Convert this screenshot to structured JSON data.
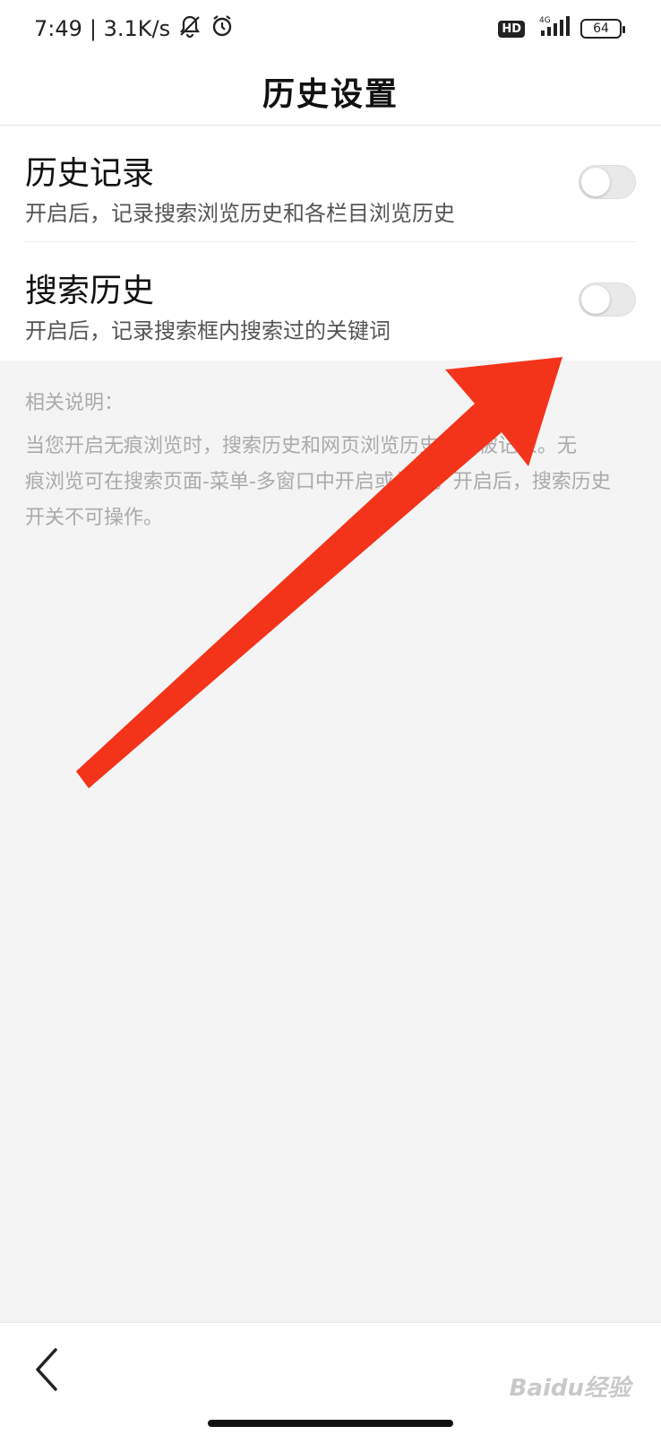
{
  "status_bar": {
    "time": "7:49",
    "network_speed": "| 3.1K/s",
    "mute_icon": "bell-off-icon",
    "alarm_icon": "alarm-clock-icon",
    "hd_label": "HD",
    "network_type": "4G",
    "battery": "64"
  },
  "header": {
    "title": "历史设置"
  },
  "settings": [
    {
      "title": "历史记录",
      "description": "开启后，记录搜索浏览历史和各栏目浏览历史",
      "enabled": false
    },
    {
      "title": "搜索历史",
      "description": "开启后，记录搜索框内搜索过的关键词",
      "enabled": false
    }
  ],
  "notes": {
    "heading": "相关说明：",
    "lines": [
      "当您开启无痕浏览时，搜索历史和网页浏览历史不会被记录。无",
      "痕浏览可在搜索页面-菜单-多窗口中开启或关闭。开启后，搜索历史",
      "开关不可操作。"
    ]
  },
  "bottom_bar": {
    "back_icon": "chevron-left-icon",
    "watermark": "Baidu经验"
  },
  "colors": {
    "annotation_arrow": "#f4341a",
    "background": "#f4f4f4",
    "card": "#ffffff"
  }
}
